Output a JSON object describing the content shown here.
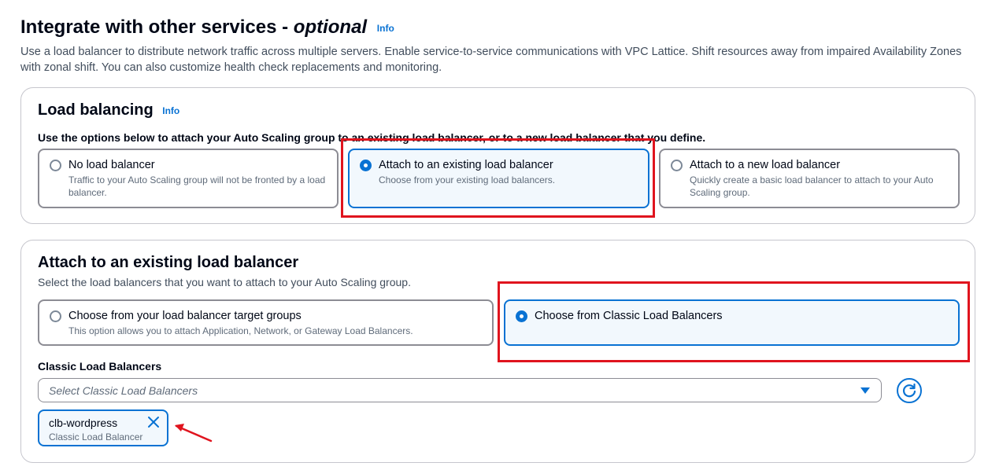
{
  "header": {
    "title_main": "Integrate with other services - ",
    "title_optional": "optional",
    "info_label": "Info",
    "description": "Use a load balancer to distribute network traffic across multiple servers. Enable service-to-service communications with VPC Lattice. Shift resources away from impaired Availability Zones with zonal shift. You can also customize health check replacements and monitoring."
  },
  "load_balancing": {
    "title": "Load balancing",
    "info_label": "Info",
    "subtitle": "Use the options below to attach your Auto Scaling group to an existing load balancer, or to a new load balancer that you define.",
    "options": [
      {
        "label": "No load balancer",
        "description": "Traffic to your Auto Scaling group will not be fronted by a load balancer.",
        "selected": false
      },
      {
        "label": "Attach to an existing load balancer",
        "description": "Choose from your existing load balancers.",
        "selected": true
      },
      {
        "label": "Attach to a new load balancer",
        "description": "Quickly create a basic load balancer to attach to your Auto Scaling group.",
        "selected": false
      }
    ]
  },
  "existing_lb": {
    "title": "Attach to an existing load balancer",
    "subtitle": "Select the load balancers that you want to attach to your Auto Scaling group.",
    "options": [
      {
        "label": "Choose from your load balancer target groups",
        "description": "This option allows you to attach Application, Network, or Gateway Load Balancers.",
        "selected": false
      },
      {
        "label": "Choose from Classic Load Balancers",
        "description": "",
        "selected": true
      }
    ],
    "field_label": "Classic Load Balancers",
    "select_placeholder": "Select Classic Load Balancers",
    "tokens": [
      {
        "name": "clb-wordpress",
        "description": "Classic Load Balancer"
      }
    ]
  },
  "colors": {
    "accent": "#0972d3",
    "annotation": "#e0141e",
    "selected_bg": "#f2f8fd"
  },
  "icons": [
    "radio-icon",
    "caret-down-icon",
    "refresh-icon",
    "close-icon",
    "annotation-arrow-icon"
  ]
}
